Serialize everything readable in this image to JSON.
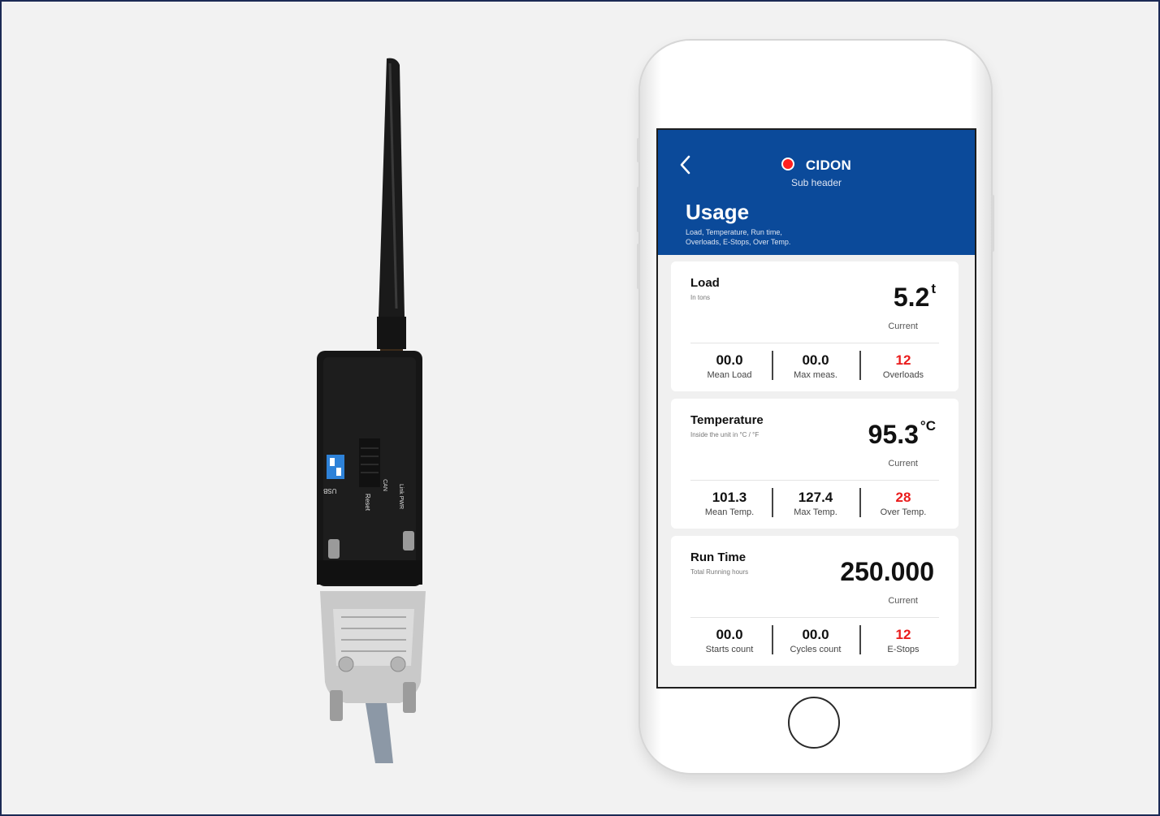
{
  "colors": {
    "header": "#0b4a9a",
    "status_dot": "#ff1f1f",
    "alert": "#ea1c1c",
    "background": "#f2f2f2"
  },
  "device": {
    "labels": {
      "usb": "USB",
      "reset": "Reset",
      "link": "Link PWR",
      "can": "CAN"
    }
  },
  "app": {
    "back_icon": "chevron-left-icon",
    "title": "CIDON",
    "subheader": "Sub header",
    "section_title": "Usage",
    "section_desc_line1": "Load, Temperature, Run time,",
    "section_desc_line2": "Overloads, E-Stops, Over Temp."
  },
  "cards": [
    {
      "title": "Load",
      "subtitle": "In tons",
      "value": "5.2",
      "unit": "t",
      "current_label": "Current",
      "stats": [
        {
          "value": "00.0",
          "label": "Mean Load"
        },
        {
          "value": "00.0",
          "label": "Max meas."
        },
        {
          "value": "12",
          "label": "Overloads"
        }
      ]
    },
    {
      "title": "Temperature",
      "subtitle": "Inside the unit in °C / °F",
      "value": "95.3",
      "unit": "°C",
      "current_label": "Current",
      "stats": [
        {
          "value": "101.3",
          "label": "Mean Temp."
        },
        {
          "value": "127.4",
          "label": "Max Temp."
        },
        {
          "value": "28",
          "label": "Over Temp."
        }
      ]
    },
    {
      "title": "Run Time",
      "subtitle": "Total Running hours",
      "value": "250.000",
      "unit": "",
      "current_label": "Current",
      "stats": [
        {
          "value": "00.0",
          "label": "Starts count"
        },
        {
          "value": "00.0",
          "label": "Cycles count"
        },
        {
          "value": "12",
          "label": "E-Stops"
        }
      ]
    }
  ]
}
